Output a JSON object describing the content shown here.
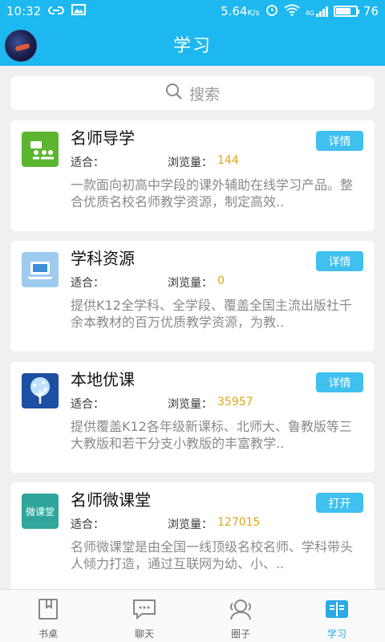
{
  "status_bar": {
    "time": "10:32",
    "speed_value": "5.64",
    "speed_unit": "K/s",
    "network": "4G",
    "battery": "76",
    "battery_level": 0.76
  },
  "header": {
    "title": "学习"
  },
  "search": {
    "placeholder": "搜索"
  },
  "items": [
    {
      "name": "名师导学",
      "suit_label": "适合：",
      "views_label": "浏览量：",
      "views": "144",
      "action": "详情",
      "description": "一款面向初高中学段的课外辅助在线学习产品。整合优质名校名师教学资源，制定高效.."
    },
    {
      "name": "学科资源",
      "suit_label": "适合：",
      "views_label": "浏览量：",
      "views": "0",
      "action": "详情",
      "description": "提供K12全学科、全学段、覆盖全国主流出版社千余本教材的百万优质教学资源，为教.."
    },
    {
      "name": "本地优课",
      "suit_label": "适合：",
      "views_label": "浏览量：",
      "views": "35957",
      "action": "详情",
      "description": "提供覆盖K12各年级新课标、北师大、鲁教版等三大教版和若干分支小教版的丰富教学.."
    },
    {
      "name": "名师微课堂",
      "suit_label": "适合：",
      "views_label": "浏览量：",
      "views": "127015",
      "action": "打开",
      "description": "名师微课堂是由全国一线顶级名校名师、学科带头人倾力打造，通过互联网为幼、小、.."
    }
  ],
  "logo_text_4": "微课堂",
  "tabs": [
    {
      "label": "书桌",
      "icon": "book-icon"
    },
    {
      "label": "聊天",
      "icon": "chat-icon"
    },
    {
      "label": "圈子",
      "icon": "circle-group-icon"
    },
    {
      "label": "学习",
      "icon": "study-icon",
      "active": true
    }
  ],
  "colors": {
    "brand": "#1db8ef",
    "button": "#3fc0ee",
    "views": "#e0a418"
  }
}
